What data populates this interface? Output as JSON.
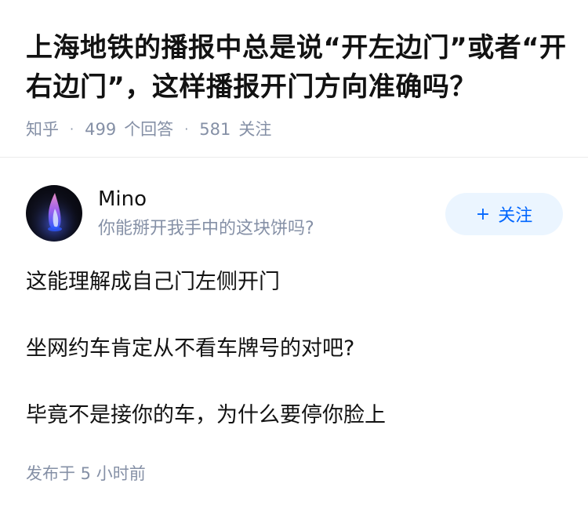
{
  "question": {
    "title": "上海地铁的播报中总是说“开左边门”或者“开右边门”，这样播报开门方向准确吗？",
    "source": "知乎",
    "answer_count": "499",
    "answer_label": "个回答",
    "follower_count": "581",
    "follower_label": "关注",
    "separator": "·"
  },
  "author": {
    "name": "Mino",
    "bio": "你能掰开我手中的这块饼吗?",
    "follow_plus": "+",
    "follow_label": "关注"
  },
  "answer": {
    "paragraphs": [
      "这能理解成自己门左侧开门",
      "坐网约车肯定从不看车牌号的对吧?",
      "毕竟不是接你的车，为什么要停你脸上"
    ],
    "published": "发布于 5 小时前"
  },
  "colors": {
    "accent": "#0066ff",
    "accent_bg": "#ebf5ff",
    "meta_text": "#8590a6",
    "main_text": "#121212"
  },
  "icons": {
    "avatar": "flame-avatar"
  }
}
